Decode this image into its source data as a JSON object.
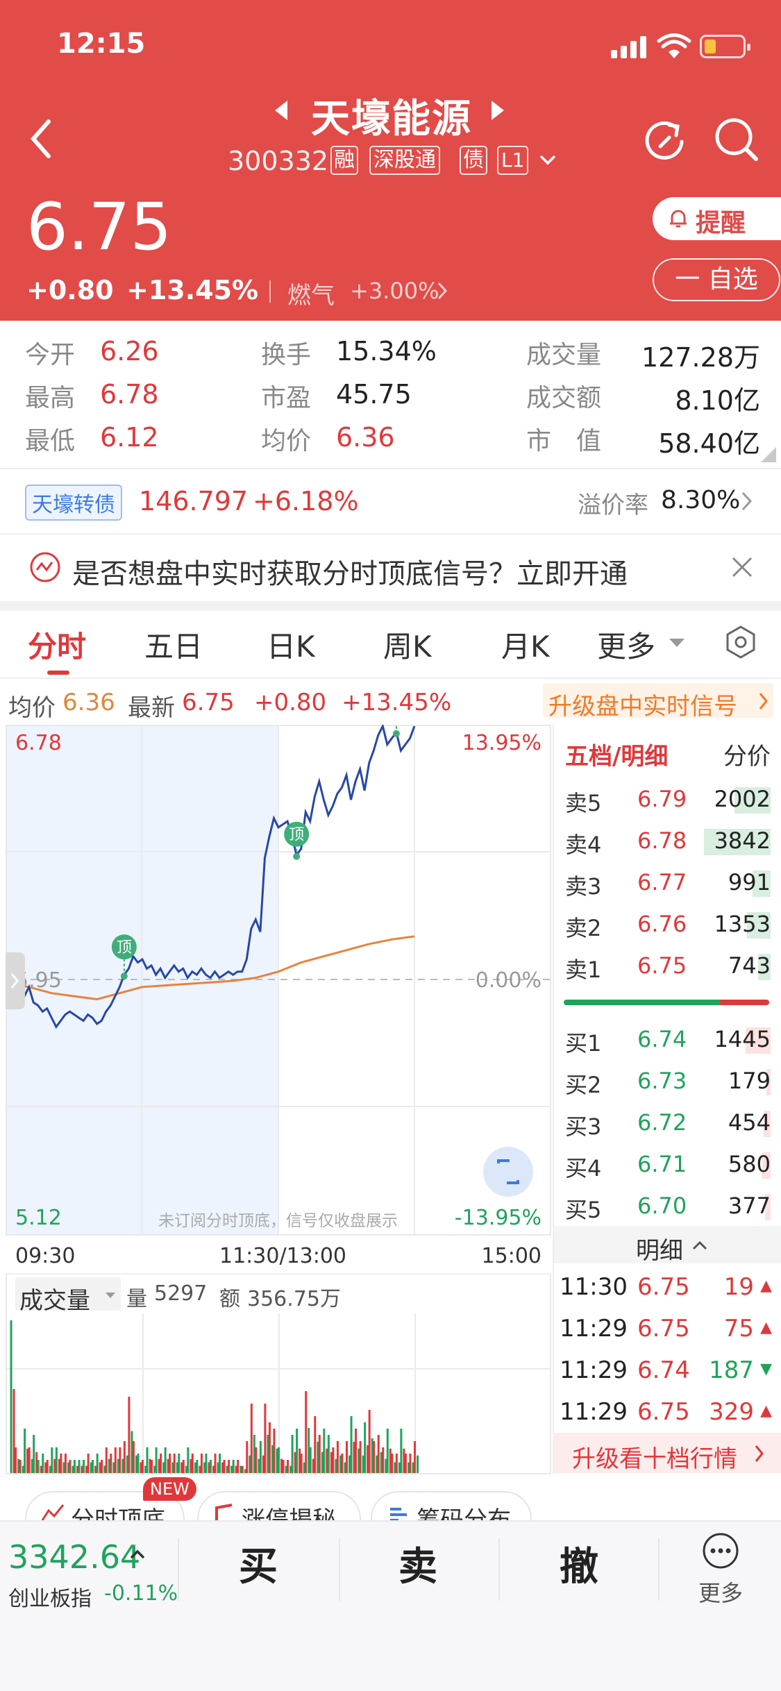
{
  "status_bar": {
    "time": "12:15"
  },
  "header": {
    "title": "天壕能源",
    "code": "300332",
    "tags": [
      "融",
      "深股通",
      "债",
      "L1"
    ],
    "price": "6.75",
    "change": "+0.80",
    "change_pct": "+13.45%",
    "sector": "燃气",
    "sector_pct": "+3.00%",
    "alert_label": "提醒",
    "watchlist_label": "一 自选"
  },
  "stats": {
    "open_label": "今开",
    "open": "6.26",
    "high_label": "最高",
    "high": "6.78",
    "low_label": "最低",
    "low": "6.12",
    "turnover_label": "换手",
    "turnover": "15.34%",
    "pe_label": "市盈",
    "pe": "45.75",
    "avg_label": "均价",
    "avg": "6.36",
    "volume_label": "成交量",
    "volume": "127.28万",
    "amount_label": "成交额",
    "amount": "8.10亿",
    "mcap_label": "市　值",
    "mcap": "58.40亿"
  },
  "bond": {
    "name": "天壕转债",
    "price": "146.797",
    "pct": "+6.18%",
    "premium_label": "溢价率",
    "premium": "8.30%"
  },
  "banner": {
    "text": "是否想盘中实时获取分时顶底信号？立即开通"
  },
  "tabs": [
    "分时",
    "五日",
    "日K",
    "周K",
    "月K",
    "更多"
  ],
  "info_bar": {
    "avg_label": "均价",
    "avg": "6.36",
    "latest_label": "最新",
    "latest": "6.75",
    "change": "+0.80",
    "pct": "+13.45%",
    "upgrade": "升级盘中实时信号"
  },
  "chart_labels": {
    "max": "6.78",
    "max_pct": "13.95%",
    "mid": "5.95",
    "mid_pct": "0.00%",
    "min": "5.12",
    "min_pct": "-13.95%",
    "note": "未订阅分时顶底，信号仅收盘展示",
    "top_signal": "顶",
    "t_open": "09:30",
    "t_mid": "11:30/13:00",
    "t_close": "15:00"
  },
  "chart_data": {
    "type": "line",
    "ylim": [
      5.12,
      6.78
    ],
    "y_ref": 5.95,
    "xlim": [
      0,
      240
    ],
    "series": [
      {
        "values": [
          [
            0,
            5.97
          ],
          [
            2,
            5.92
          ],
          [
            4,
            5.95
          ],
          [
            6,
            5.96
          ],
          [
            8,
            5.9
          ],
          [
            10,
            5.93
          ],
          [
            12,
            5.88
          ],
          [
            14,
            5.87
          ],
          [
            16,
            5.85
          ],
          [
            18,
            5.86
          ],
          [
            20,
            5.83
          ],
          [
            22,
            5.8
          ],
          [
            24,
            5.82
          ],
          [
            26,
            5.84
          ],
          [
            28,
            5.85
          ],
          [
            30,
            5.84
          ],
          [
            32,
            5.83
          ],
          [
            34,
            5.82
          ],
          [
            36,
            5.84
          ],
          [
            38,
            5.83
          ],
          [
            40,
            5.81
          ],
          [
            42,
            5.82
          ],
          [
            44,
            5.85
          ],
          [
            46,
            5.87
          ],
          [
            48,
            5.9
          ],
          [
            50,
            5.93
          ],
          [
            52,
            5.97
          ],
          [
            54,
            5.99
          ],
          [
            56,
            6.03
          ],
          [
            58,
            6.01
          ],
          [
            60,
            6.02
          ],
          [
            62,
            5.99
          ],
          [
            64,
            6.0
          ],
          [
            66,
            5.97
          ],
          [
            68,
            5.99
          ],
          [
            70,
            5.96
          ],
          [
            72,
            5.98
          ],
          [
            74,
            6.0
          ],
          [
            76,
            5.98
          ],
          [
            78,
            5.99
          ],
          [
            80,
            5.96
          ],
          [
            82,
            5.98
          ],
          [
            84,
            5.97
          ],
          [
            86,
            5.99
          ],
          [
            88,
            5.97
          ],
          [
            90,
            5.96
          ],
          [
            92,
            5.98
          ],
          [
            94,
            5.96
          ],
          [
            96,
            5.97
          ],
          [
            98,
            5.98
          ],
          [
            100,
            5.97
          ],
          [
            102,
            5.98
          ],
          [
            104,
            5.98
          ],
          [
            106,
            6.02
          ],
          [
            108,
            6.12
          ],
          [
            110,
            6.15
          ],
          [
            112,
            6.11
          ],
          [
            114,
            6.35
          ],
          [
            116,
            6.42
          ],
          [
            118,
            6.48
          ],
          [
            120,
            6.45
          ],
          [
            122,
            6.46
          ],
          [
            124,
            6.47
          ],
          [
            126,
            6.42
          ],
          [
            128,
            6.36
          ],
          [
            130,
            6.38
          ],
          [
            132,
            6.5
          ],
          [
            134,
            6.47
          ],
          [
            136,
            6.55
          ],
          [
            138,
            6.6
          ],
          [
            140,
            6.54
          ],
          [
            142,
            6.49
          ],
          [
            144,
            6.52
          ],
          [
            146,
            6.56
          ],
          [
            148,
            6.58
          ],
          [
            150,
            6.62
          ],
          [
            152,
            6.54
          ],
          [
            154,
            6.6
          ],
          [
            156,
            6.64
          ],
          [
            158,
            6.57
          ],
          [
            160,
            6.66
          ],
          [
            162,
            6.7
          ],
          [
            164,
            6.75
          ],
          [
            166,
            6.78
          ],
          [
            168,
            6.72
          ],
          [
            170,
            6.74
          ],
          [
            172,
            6.76
          ],
          [
            174,
            6.7
          ],
          [
            176,
            6.72
          ],
          [
            178,
            6.74
          ],
          [
            180,
            6.78
          ]
        ]
      },
      {
        "values": [
          [
            0,
            5.94
          ],
          [
            10,
            5.93
          ],
          [
            20,
            5.91
          ],
          [
            30,
            5.9
          ],
          [
            40,
            5.89
          ],
          [
            50,
            5.91
          ],
          [
            60,
            5.93
          ],
          [
            70,
            5.935
          ],
          [
            80,
            5.94
          ],
          [
            90,
            5.945
          ],
          [
            100,
            5.95
          ],
          [
            110,
            5.96
          ],
          [
            120,
            5.98
          ],
          [
            130,
            6.01
          ],
          [
            140,
            6.03
          ],
          [
            150,
            6.05
          ],
          [
            160,
            6.07
          ],
          [
            170,
            6.085
          ],
          [
            180,
            6.095
          ]
        ]
      }
    ]
  },
  "volume_panel": {
    "label": "成交量",
    "qty_label": "量",
    "qty": "5297",
    "amt_label": "额",
    "amt": "356.75万"
  },
  "order_book": {
    "header": "五档/明细",
    "header_right": "分价",
    "asks": [
      {
        "label": "卖5",
        "price": "6.79",
        "vol": "2002"
      },
      {
        "label": "卖4",
        "price": "6.78",
        "vol": "3842"
      },
      {
        "label": "卖3",
        "price": "6.77",
        "vol": "991"
      },
      {
        "label": "卖2",
        "price": "6.76",
        "vol": "1353"
      },
      {
        "label": "卖1",
        "price": "6.75",
        "vol": "743"
      }
    ],
    "bids": [
      {
        "label": "买1",
        "price": "6.74",
        "vol": "1445"
      },
      {
        "label": "买2",
        "price": "6.73",
        "vol": "179"
      },
      {
        "label": "买3",
        "price": "6.72",
        "vol": "454"
      },
      {
        "label": "买4",
        "price": "6.71",
        "vol": "580"
      },
      {
        "label": "买5",
        "price": "6.70",
        "vol": "377"
      }
    ],
    "detail_label": "明细",
    "trades": [
      {
        "time": "11:30",
        "price": "6.75",
        "vol": "19",
        "dir": "▲"
      },
      {
        "time": "11:29",
        "price": "6.75",
        "vol": "75",
        "dir": "▲"
      },
      {
        "time": "11:29",
        "price": "6.74",
        "vol": "187",
        "dir": "▼"
      },
      {
        "time": "11:29",
        "price": "6.75",
        "vol": "329",
        "dir": "▲"
      }
    ],
    "upgrade": "升级看十档行情"
  },
  "features": {
    "a": "分时顶底",
    "a_badge": "NEW",
    "b": "涨停揭秘",
    "c": "筹码分布"
  },
  "bottom": {
    "index_value": "3342.64",
    "index_name": "创业板指",
    "index_pct": "-0.11%",
    "buy": "买",
    "sell": "卖",
    "cancel": "撤",
    "more": "更多"
  }
}
